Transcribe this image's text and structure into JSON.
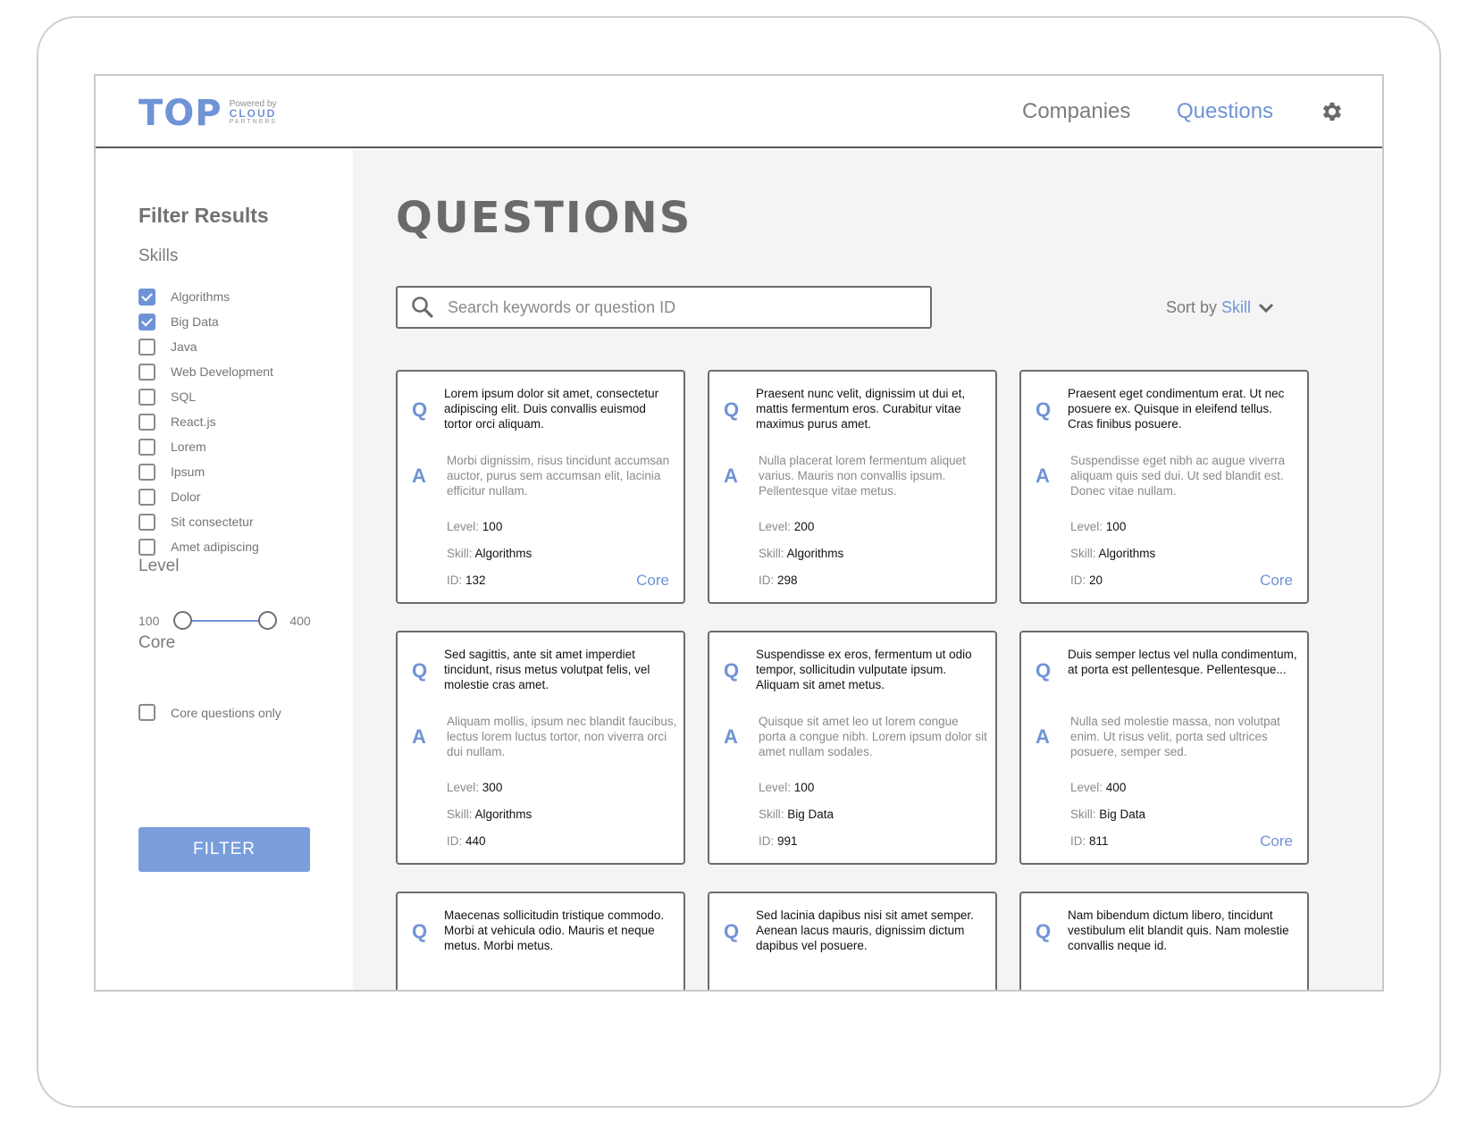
{
  "header": {
    "logo_text": "TOP",
    "logo_powered": "Powered by",
    "logo_brand": "CLOUD",
    "logo_partners": "PARTNERS",
    "nav": {
      "companies": "Companies",
      "questions": "Questions"
    }
  },
  "sidebar": {
    "title": "Filter Results",
    "skills_heading": "Skills",
    "skills": [
      {
        "label": "Algorithms",
        "checked": true
      },
      {
        "label": "Big Data",
        "checked": true
      },
      {
        "label": "Java",
        "checked": false
      },
      {
        "label": "Web Development",
        "checked": false
      },
      {
        "label": "SQL",
        "checked": false
      },
      {
        "label": "React.js",
        "checked": false
      },
      {
        "label": "Lorem",
        "checked": false
      },
      {
        "label": "Ipsum",
        "checked": false
      },
      {
        "label": "Dolor",
        "checked": false
      },
      {
        "label": "Sit consectetur",
        "checked": false
      },
      {
        "label": "Amet adipiscing",
        "checked": false
      }
    ],
    "level_heading": "Level",
    "level_min": "100",
    "level_max": "400",
    "core_heading": "Core",
    "core_label": "Core questions only",
    "core_checked": false,
    "filter_label": "FILTER"
  },
  "main": {
    "title": "QUESTIONS",
    "search_placeholder": "Search keywords or question ID",
    "sort_label": "Sort by",
    "sort_value": "Skill",
    "labels": {
      "q": "Q",
      "a": "A",
      "level": "Level:",
      "skill": "Skill:",
      "id": "ID:",
      "core": "Core"
    },
    "cards": [
      {
        "q": "Lorem ipsum dolor sit amet, consectetur adipiscing elit. Duis convallis euismod tortor orci aliquam.",
        "a": "Morbi dignissim, risus tincidunt accumsan auctor, purus sem accumsan elit, lacinia efficitur nullam.",
        "level": "100",
        "skill": "Algorithms",
        "id": "132",
        "core": "Core"
      },
      {
        "q": "Praesent nunc velit, dignissim ut dui et, mattis fermentum eros. Curabitur vitae maximus purus amet.",
        "a": "Nulla placerat lorem fermentum aliquet varius. Mauris non convallis ipsum. Pellentesque vitae metus.",
        "level": "200",
        "skill": "Algorithms",
        "id": "298",
        "core": ""
      },
      {
        "q": "Praesent eget condimentum erat. Ut nec posuere ex. Quisque in eleifend tellus. Cras finibus posuere.",
        "a": "Suspendisse eget nibh ac augue viverra aliquam quis sed dui. Ut sed blandit est. Donec vitae nullam.",
        "level": "100",
        "skill": "Algorithms",
        "id": "20",
        "core": "Core"
      },
      {
        "q": "Sed sagittis, ante sit amet imperdiet tincidunt, risus metus volutpat felis, vel molestie cras amet.",
        "a": "Aliquam mollis, ipsum nec blandit faucibus, lectus lorem luctus tortor, non viverra orci dui nullam.",
        "level": "300",
        "skill": "Algorithms",
        "id": "440",
        "core": ""
      },
      {
        "q": "Suspendisse ex eros, fermentum ut odio tempor, sollicitudin vulputate ipsum. Aliquam sit amet metus.",
        "a": "Quisque sit amet leo ut lorem congue porta a congue nibh. Lorem ipsum dolor sit amet nullam sodales.",
        "level": "100",
        "skill": "Big Data",
        "id": "991",
        "core": ""
      },
      {
        "q": "Duis semper lectus vel nulla condimentum, at porta est pellentesque. Pellentesque...",
        "a": "Nulla sed molestie massa, non volutpat enim. Ut risus velit, porta sed ultrices posuere, semper sed.",
        "level": "400",
        "skill": "Big Data",
        "id": "811",
        "core": "Core"
      },
      {
        "q": "Maecenas sollicitudin tristique commodo. Morbi at vehicula odio. Mauris et neque metus. Morbi metus.",
        "a": "",
        "level": "",
        "skill": "",
        "id": "",
        "core": ""
      },
      {
        "q": "Sed lacinia dapibus nisi sit amet semper. Aenean lacus mauris, dignissim dictum dapibus vel posuere.",
        "a": "",
        "level": "",
        "skill": "",
        "id": "",
        "core": ""
      },
      {
        "q": "Nam bibendum dictum libero, tincidunt vestibulum elit blandit quis. Nam molestie convallis neque id.",
        "a": "",
        "level": "",
        "skill": "",
        "id": "",
        "core": ""
      }
    ]
  },
  "colors": {
    "accent": "#6f93d6",
    "button": "#7a9ddb",
    "main_bg": "#f4f4f4",
    "title": "#6a6a6a"
  }
}
